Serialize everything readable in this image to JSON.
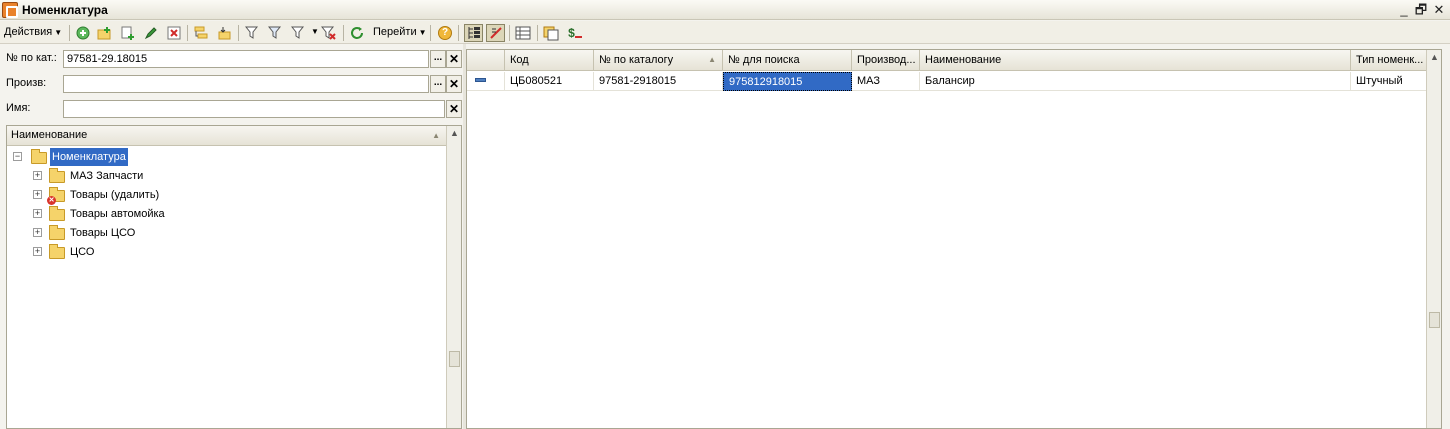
{
  "window": {
    "title": "Номенклатура",
    "controls": {
      "minimize": "_",
      "restore": "🗗",
      "close": "✕"
    }
  },
  "toolbar": {
    "actions_label": "Действия",
    "goto_label": "Перейти",
    "help_glyph": "?",
    "icons": [
      "add-icon",
      "add-group-icon",
      "copy-icon",
      "edit-icon",
      "delete-icon",
      "hierarchy-icon",
      "move-to-group-icon",
      "filter-icon",
      "filter-by-value-icon",
      "filter-history-icon",
      "clear-filter-icon",
      "refresh-icon",
      "help-icon",
      "tree-view-icon",
      "hierarchical-list-icon",
      "columns-icon",
      "report-icon",
      "price-icon"
    ],
    "price_glyph": "$"
  },
  "filters": {
    "catalog_label": "№ по кат.:",
    "catalog_value": "97581-29.18015",
    "manufacturer_label": "Произв:",
    "manufacturer_value": "",
    "name_label": "Имя:",
    "name_value": "",
    "dots_glyph": "...",
    "clear_glyph": "✕"
  },
  "tree": {
    "header": "Наименование",
    "root": "Номенклатура",
    "items": [
      {
        "label": "МАЗ Запчасти",
        "marked_deleted": false
      },
      {
        "label": "Товары (удалить)",
        "marked_deleted": true
      },
      {
        "label": "Товары автомойка",
        "marked_deleted": false
      },
      {
        "label": "Товары ЦСО",
        "marked_deleted": false
      },
      {
        "label": "ЦСО",
        "marked_deleted": false
      }
    ]
  },
  "grid": {
    "columns": [
      "Код",
      "№ по каталогу",
      "№ для поиска",
      "Производ...",
      "Наименование",
      "Тип номенк..."
    ],
    "rows": [
      {
        "code": "ЦБ080521",
        "catalog_no": "97581-2918015",
        "search_no": "975812918015",
        "manufacturer": "МАЗ",
        "name": "Балансир",
        "type": "Штучный"
      }
    ]
  },
  "colors": {
    "selection": "#316ac5",
    "folder": "#f5d36a",
    "background": "#f4f3ee"
  }
}
